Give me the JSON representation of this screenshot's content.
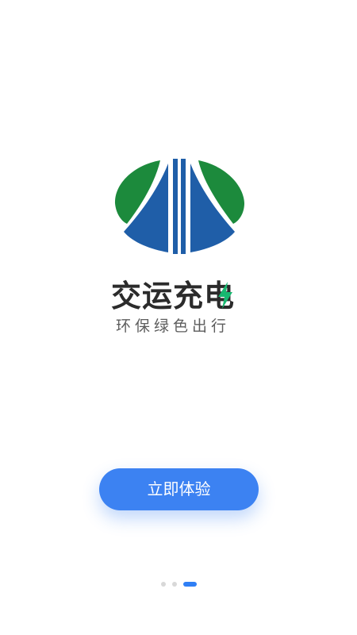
{
  "app": {
    "brand_name": "交运充电",
    "tagline": "环保绿色出行"
  },
  "cta": {
    "label": "立即体验"
  },
  "pager": {
    "pages": 3,
    "active_index": 2
  },
  "colors": {
    "logo_green": "#1c8a3c",
    "logo_blue": "#1f5ea8",
    "bolt_green": "#18b870",
    "button_blue": "#3c82f2",
    "dot_inactive": "#d8d8d8",
    "dot_active": "#2f7ff5"
  },
  "icons": {
    "logo": "road-oval-logo",
    "bolt": "lightning-bolt-icon"
  }
}
